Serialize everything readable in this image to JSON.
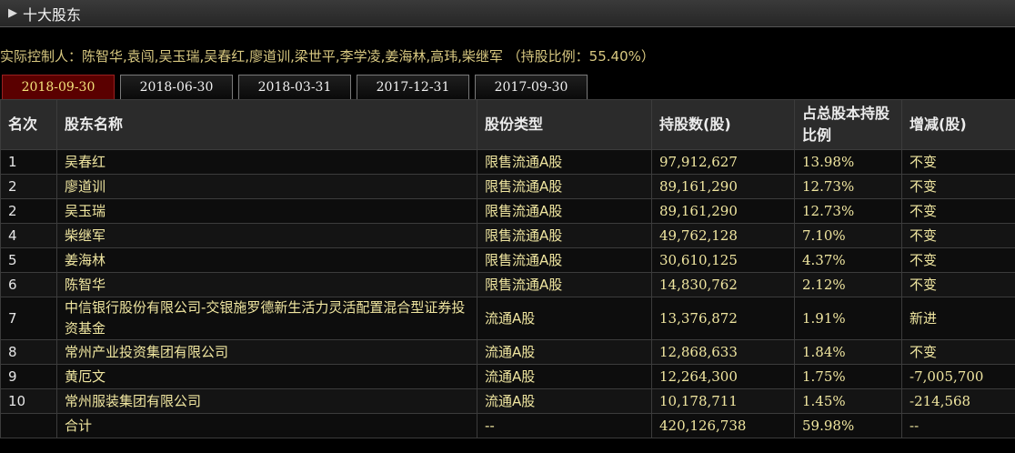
{
  "panel": {
    "title": "十大股东",
    "toggle_icon": "▶"
  },
  "controller_text": "实际控制人：陈智华,袁闯,吴玉瑞,吴春红,廖道训,梁世平,李学凌,姜海林,高玮,柴继军 （持股比例：55.40%）",
  "tabs": [
    {
      "label": "2018-09-30",
      "active": true
    },
    {
      "label": "2018-06-30",
      "active": false
    },
    {
      "label": "2018-03-31",
      "active": false
    },
    {
      "label": "2017-12-31",
      "active": false
    },
    {
      "label": "2017-09-30",
      "active": false
    }
  ],
  "table": {
    "headers": [
      "名次",
      "股东名称",
      "股份类型",
      "持股数(股)",
      "占总股本持股比例",
      "增减(股)"
    ],
    "rows": [
      {
        "rank": "1",
        "name": "吴春红",
        "type": "限售流通A股",
        "shares": "97,912,627",
        "ratio": "13.98%",
        "change": "不变"
      },
      {
        "rank": "2",
        "name": "廖道训",
        "type": "限售流通A股",
        "shares": "89,161,290",
        "ratio": "12.73%",
        "change": "不变"
      },
      {
        "rank": "2",
        "name": "吴玉瑞",
        "type": "限售流通A股",
        "shares": "89,161,290",
        "ratio": "12.73%",
        "change": "不变"
      },
      {
        "rank": "4",
        "name": "柴继军",
        "type": "限售流通A股",
        "shares": "49,762,128",
        "ratio": "7.10%",
        "change": "不变"
      },
      {
        "rank": "5",
        "name": "姜海林",
        "type": "限售流通A股",
        "shares": "30,610,125",
        "ratio": "4.37%",
        "change": "不变"
      },
      {
        "rank": "6",
        "name": "陈智华",
        "type": "限售流通A股",
        "shares": "14,830,762",
        "ratio": "2.12%",
        "change": "不变"
      },
      {
        "rank": "7",
        "name": "中信银行股份有限公司-交银施罗德新生活力灵活配置混合型证券投资基金",
        "type": "流通A股",
        "shares": "13,376,872",
        "ratio": "1.91%",
        "change": "新进"
      },
      {
        "rank": "8",
        "name": "常州产业投资集团有限公司",
        "type": "流通A股",
        "shares": "12,868,633",
        "ratio": "1.84%",
        "change": "不变"
      },
      {
        "rank": "9",
        "name": "黄厄文",
        "type": "流通A股",
        "shares": "12,264,300",
        "ratio": "1.75%",
        "change": "-7,005,700"
      },
      {
        "rank": "10",
        "name": "常州服装集团有限公司",
        "type": "流通A股",
        "shares": "10,178,711",
        "ratio": "1.45%",
        "change": "-214,568"
      }
    ],
    "total": {
      "rank": "",
      "name": "合计",
      "type": "--",
      "shares": "420,126,738",
      "ratio": "59.98%",
      "change": "--"
    }
  }
}
